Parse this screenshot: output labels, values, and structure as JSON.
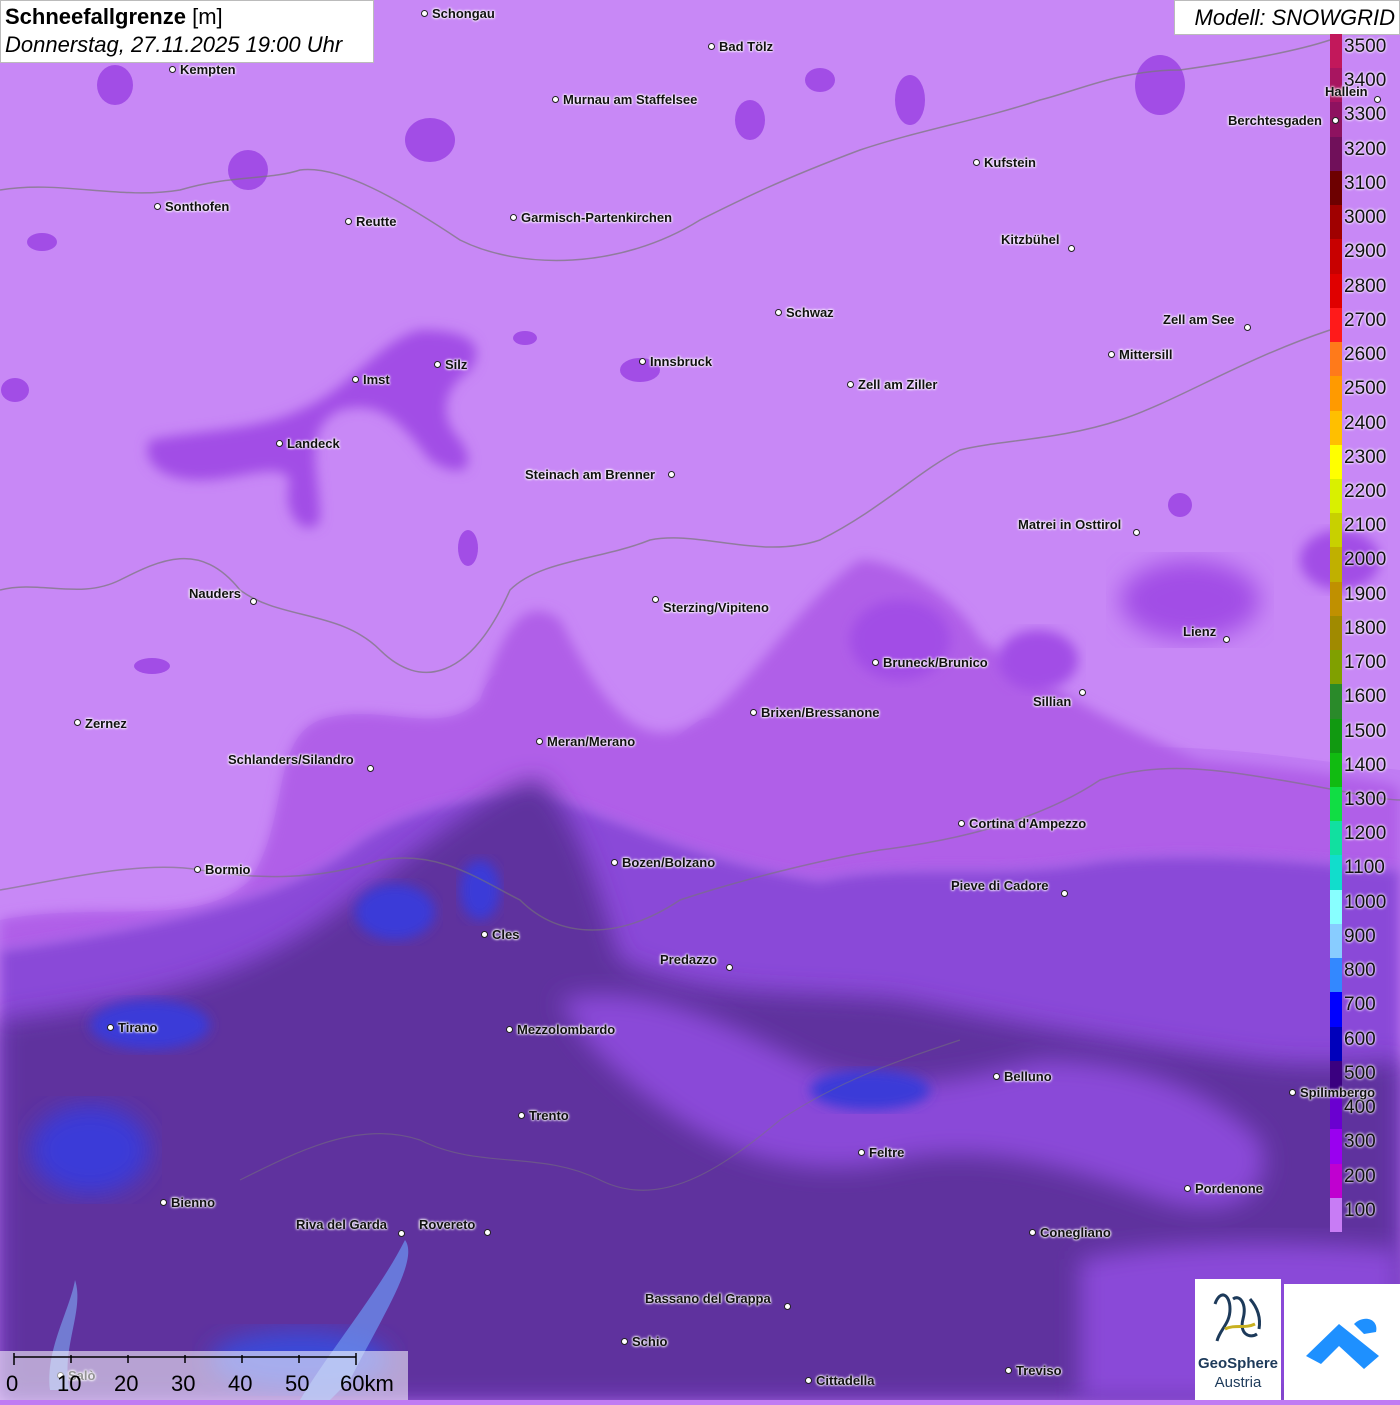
{
  "header": {
    "title_bold": "Schneefallgrenze",
    "title_unit": "[m]",
    "datetime": "Donnerstag, 27.11.2025 19:00 Uhr",
    "model": "Modell: SNOWGRID"
  },
  "legend": {
    "labels": [
      "3500",
      "3400",
      "3300",
      "3200",
      "3100",
      "3000",
      "2900",
      "2800",
      "2700",
      "2600",
      "2500",
      "2400",
      "2300",
      "2200",
      "2100",
      "2000",
      "1900",
      "1800",
      "1700",
      "1600",
      "1500",
      "1400",
      "1300",
      "1200",
      "1100",
      "1000",
      "900",
      "800",
      "700",
      "600",
      "500",
      "400",
      "300",
      "200",
      "100"
    ],
    "colors": [
      "#c2185b",
      "#a81560",
      "#8e1260",
      "#70105a",
      "#6d0000",
      "#a00000",
      "#c80000",
      "#e00000",
      "#ff1a1a",
      "#ff7a1a",
      "#ff9a00",
      "#ffbf00",
      "#ffff00",
      "#d9f000",
      "#c8d000",
      "#c0b000",
      "#c09000",
      "#a08a00",
      "#80a000",
      "#2a8a2a",
      "#119911",
      "#11bb11",
      "#11dd44",
      "#11e0a0",
      "#11ddcc",
      "#88ffff",
      "#88ccff",
      "#3388ff",
      "#0000ff",
      "#0000bb",
      "#3a0080",
      "#6a00d0",
      "#9a00f0",
      "#c000d0",
      "#c87cf5"
    ]
  },
  "cities": [
    {
      "name": "Schongau"
    },
    {
      "name": "Kempten"
    },
    {
      "name": "Bad Tölz"
    },
    {
      "name": "Murnau am Staffelsee"
    },
    {
      "name": "Hallein"
    },
    {
      "name": "Berchtesgaden"
    },
    {
      "name": "Kufstein"
    },
    {
      "name": "Sonthofen"
    },
    {
      "name": "Reutte"
    },
    {
      "name": "Garmisch-Partenkirchen"
    },
    {
      "name": "Kitzbühel"
    },
    {
      "name": "Schwaz"
    },
    {
      "name": "Zell am See"
    },
    {
      "name": "Mittersill"
    },
    {
      "name": "Innsbruck"
    },
    {
      "name": "Silz"
    },
    {
      "name": "Imst"
    },
    {
      "name": "Zell am Ziller"
    },
    {
      "name": "Landeck"
    },
    {
      "name": "Steinach am Brenner"
    },
    {
      "name": "Matrei in Osttirol"
    },
    {
      "name": "Nauders"
    },
    {
      "name": "Sterzing/Vipiteno"
    },
    {
      "name": "Lienz"
    },
    {
      "name": "Bruneck/Brunico"
    },
    {
      "name": "Sillian"
    },
    {
      "name": "Zernez"
    },
    {
      "name": "Brixen/Bressanone"
    },
    {
      "name": "Meran/Merano"
    },
    {
      "name": "Schlanders/Silandro"
    },
    {
      "name": "Cortina d'Ampezzo"
    },
    {
      "name": "Bozen/Bolzano"
    },
    {
      "name": "Bormio"
    },
    {
      "name": "Pieve di Cadore"
    },
    {
      "name": "Cles"
    },
    {
      "name": "Predazzo"
    },
    {
      "name": "Tirano"
    },
    {
      "name": "Mezzolombardo"
    },
    {
      "name": "Belluno"
    },
    {
      "name": "Spilimbergo"
    },
    {
      "name": "Trento"
    },
    {
      "name": "Feltre"
    },
    {
      "name": "Pordenone"
    },
    {
      "name": "Bienno"
    },
    {
      "name": "Riva del Garda"
    },
    {
      "name": "Rovereto"
    },
    {
      "name": "Conegliano"
    },
    {
      "name": "Bassano del Grappa"
    },
    {
      "name": "Schio"
    },
    {
      "name": "Treviso"
    },
    {
      "name": "Cittadella"
    },
    {
      "name": "Salò"
    }
  ],
  "scalebar": {
    "labels": [
      "0",
      "10",
      "20",
      "30",
      "40",
      "50",
      "60km"
    ]
  },
  "logos": {
    "geosphere_line1": "GeoSphere",
    "geosphere_line2": "Austria"
  }
}
